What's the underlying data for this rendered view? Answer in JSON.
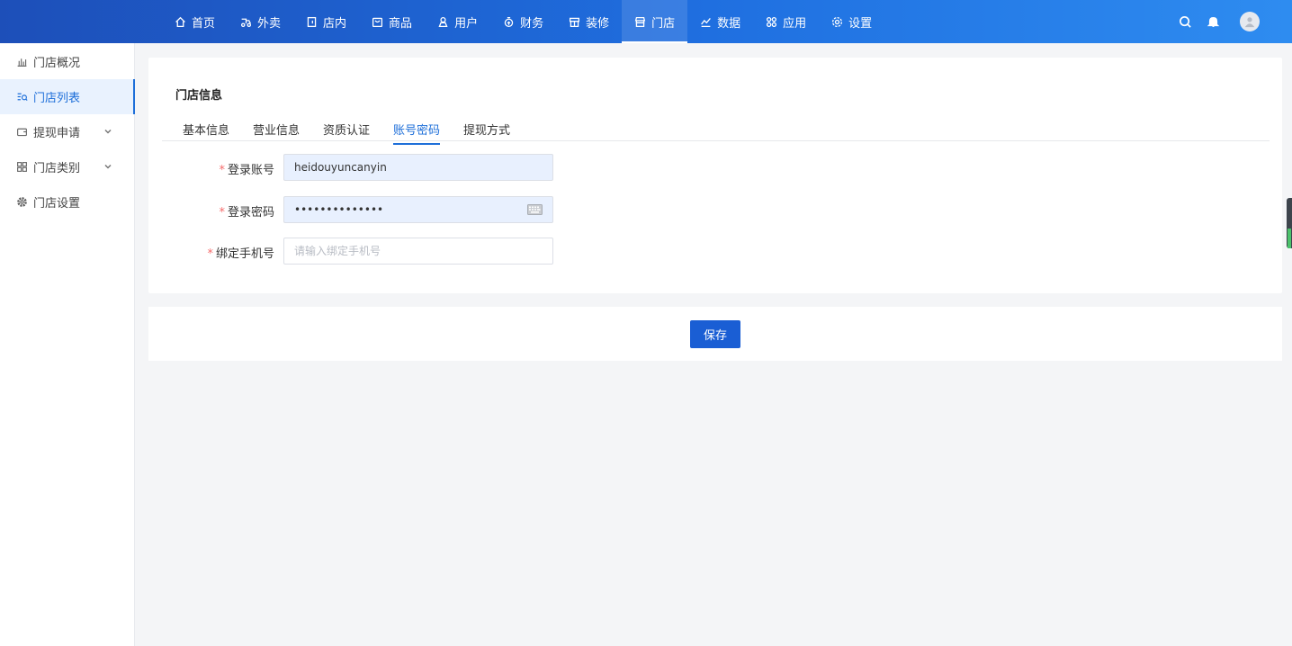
{
  "topnav": {
    "items": [
      {
        "label": "首页",
        "icon": "home-icon"
      },
      {
        "label": "外卖",
        "icon": "delivery-icon"
      },
      {
        "label": "店内",
        "icon": "dine-in-icon"
      },
      {
        "label": "商品",
        "icon": "goods-icon"
      },
      {
        "label": "用户",
        "icon": "user-icon"
      },
      {
        "label": "财务",
        "icon": "finance-icon"
      },
      {
        "label": "装修",
        "icon": "decoration-icon"
      },
      {
        "label": "门店",
        "icon": "store-icon",
        "active": true
      },
      {
        "label": "数据",
        "icon": "data-icon"
      },
      {
        "label": "应用",
        "icon": "apps-icon"
      },
      {
        "label": "设置",
        "icon": "settings-icon"
      }
    ],
    "right_icons": [
      "search-icon",
      "bell-icon",
      "avatar"
    ]
  },
  "sidebar": {
    "items": [
      {
        "label": "门店概况",
        "icon": "bar-chart-icon"
      },
      {
        "label": "门店列表",
        "icon": "list-search-icon",
        "active": true
      },
      {
        "label": "提现申请",
        "icon": "wallet-icon",
        "expandable": true
      },
      {
        "label": "门店类别",
        "icon": "grid-icon",
        "expandable": true
      },
      {
        "label": "门店设置",
        "icon": "gear-icon"
      }
    ]
  },
  "card": {
    "title": "门店信息",
    "tabs": [
      "基本信息",
      "营业信息",
      "资质认证",
      "账号密码",
      "提现方式"
    ],
    "active_tab": "账号密码"
  },
  "form": {
    "account": {
      "label": "登录账号",
      "value": "heidouyuncanyin"
    },
    "password": {
      "label": "登录密码",
      "value": "••••••••••••••"
    },
    "phone": {
      "label": "绑定手机号",
      "placeholder": "请输入绑定手机号"
    }
  },
  "actions": {
    "save_label": "保存"
  },
  "colors": {
    "primary": "#1e6fd9",
    "required": "#f56c6c",
    "topbar_start": "#1d4fb9",
    "topbar_end": "#2e8cf0"
  }
}
